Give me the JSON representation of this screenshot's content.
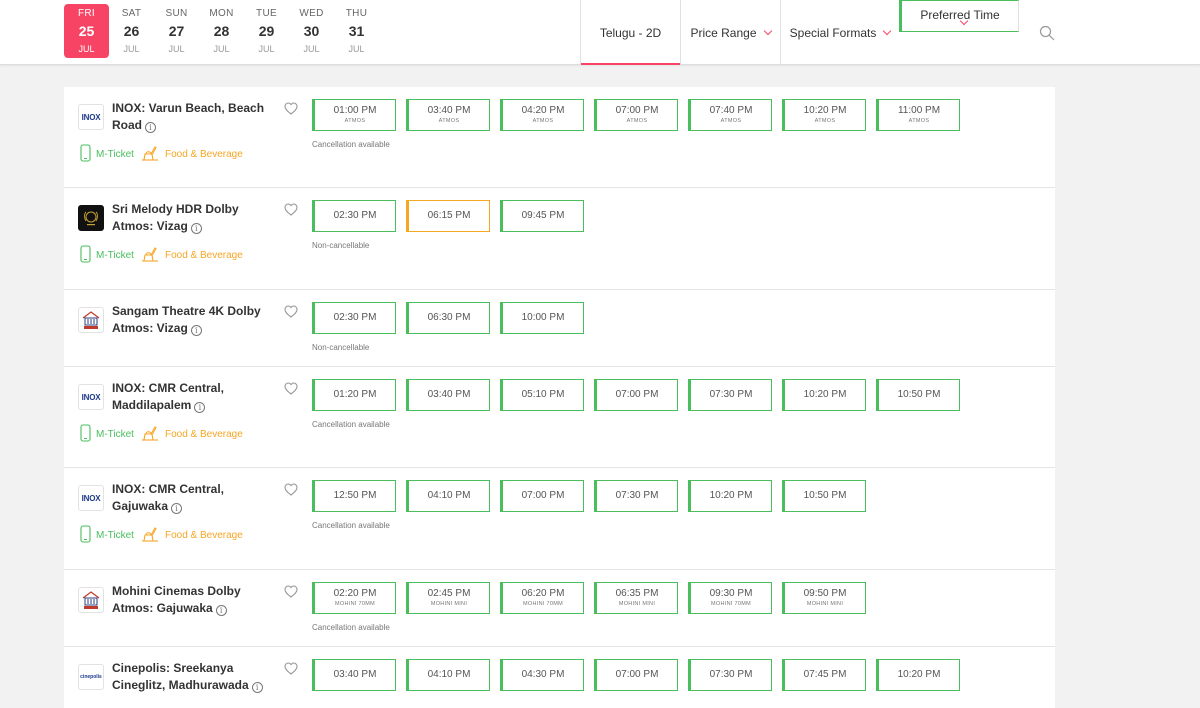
{
  "dates": [
    {
      "dow": "FRI",
      "num": "25",
      "mon": "JUL",
      "active": true
    },
    {
      "dow": "SAT",
      "num": "26",
      "mon": "JUL"
    },
    {
      "dow": "SUN",
      "num": "27",
      "mon": "JUL"
    },
    {
      "dow": "MON",
      "num": "28",
      "mon": "JUL"
    },
    {
      "dow": "TUE",
      "num": "29",
      "mon": "JUL"
    },
    {
      "dow": "WED",
      "num": "30",
      "mon": "JUL"
    },
    {
      "dow": "THU",
      "num": "31",
      "mon": "JUL"
    }
  ],
  "filters": {
    "language": "Telugu - 2D",
    "price": "Price Range",
    "formats": "Special Formats",
    "time": "Preferred Time"
  },
  "amenities": {
    "mticket": "M-Ticket",
    "food": "Food & Beverage"
  },
  "colors": {
    "accent": "#f84464",
    "available": "#4abd5d",
    "filling": "#f5a623"
  },
  "venues": [
    {
      "name": "INOX: Varun Beach, Beach Road",
      "logo": "INOX",
      "logo_icon": "inox-logo",
      "amenities": true,
      "note": "Cancellation available",
      "times": [
        {
          "t": "01:00 PM",
          "f": "ATMOS"
        },
        {
          "t": "03:40 PM",
          "f": "ATMOS"
        },
        {
          "t": "04:20 PM",
          "f": "ATMOS"
        },
        {
          "t": "07:00 PM",
          "f": "ATMOS"
        },
        {
          "t": "07:40 PM",
          "f": "ATMOS"
        },
        {
          "t": "10:20 PM",
          "f": "ATMOS"
        },
        {
          "t": "11:00 PM",
          "f": "ATMOS"
        }
      ]
    },
    {
      "name": "Sri Melody HDR Dolby Atmos: Vizag",
      "logo": "",
      "logo_icon": "melody-logo",
      "amenities": true,
      "note": "Non-cancellable",
      "times": [
        {
          "t": "02:30 PM"
        },
        {
          "t": "06:15 PM",
          "yellow": true
        },
        {
          "t": "09:45 PM"
        }
      ]
    },
    {
      "name": "Sangam Theatre 4K Dolby Atmos: Vizag",
      "logo": "",
      "logo_icon": "cinema-logo",
      "amenities": false,
      "note": "Non-cancellable",
      "times": [
        {
          "t": "02:30 PM"
        },
        {
          "t": "06:30 PM"
        },
        {
          "t": "10:00 PM"
        }
      ]
    },
    {
      "name": "INOX: CMR Central, Maddilapalem",
      "logo": "INOX",
      "logo_icon": "inox-logo",
      "amenities": true,
      "note": "Cancellation available",
      "times": [
        {
          "t": "01:20 PM"
        },
        {
          "t": "03:40 PM"
        },
        {
          "t": "05:10 PM"
        },
        {
          "t": "07:00 PM"
        },
        {
          "t": "07:30 PM"
        },
        {
          "t": "10:20 PM"
        },
        {
          "t": "10:50 PM"
        }
      ]
    },
    {
      "name": "INOX: CMR Central, Gajuwaka",
      "logo": "INOX",
      "logo_icon": "inox-logo",
      "amenities": true,
      "note": "Cancellation available",
      "times": [
        {
          "t": "12:50 PM"
        },
        {
          "t": "04:10 PM"
        },
        {
          "t": "07:00 PM"
        },
        {
          "t": "07:30 PM"
        },
        {
          "t": "10:20 PM"
        },
        {
          "t": "10:50 PM"
        }
      ]
    },
    {
      "name": "Mohini Cinemas Dolby Atmos: Gajuwaka",
      "logo": "",
      "logo_icon": "cinema-logo",
      "amenities": false,
      "note": "Cancellation available",
      "times": [
        {
          "t": "02:20 PM",
          "f": "MOHINI 70MM"
        },
        {
          "t": "02:45 PM",
          "f": "MOHINI MINI"
        },
        {
          "t": "06:20 PM",
          "f": "MOHINI 70MM"
        },
        {
          "t": "06:35 PM",
          "f": "MOHINI MINI"
        },
        {
          "t": "09:30 PM",
          "f": "MOHINI 70MM"
        },
        {
          "t": "09:50 PM",
          "f": "MOHINI MINI"
        }
      ]
    },
    {
      "name": "Cinepolis: Sreekanya Cineglitz, Madhurawada",
      "logo": "cinepolis",
      "logo_icon": "cinepolis-logo",
      "amenities": false,
      "note": "",
      "times": [
        {
          "t": "03:40 PM"
        },
        {
          "t": "04:10 PM"
        },
        {
          "t": "04:30 PM"
        },
        {
          "t": "07:00 PM"
        },
        {
          "t": "07:30 PM"
        },
        {
          "t": "07:45 PM"
        },
        {
          "t": "10:20 PM"
        }
      ]
    }
  ]
}
